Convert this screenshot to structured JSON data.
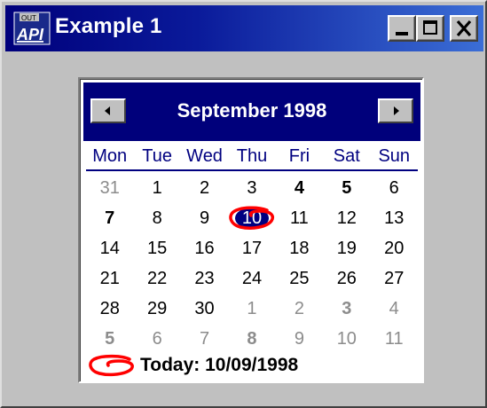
{
  "window": {
    "title": "Example 1",
    "icon": "api-app-icon",
    "buttons": [
      "minimize",
      "maximize",
      "close"
    ]
  },
  "calendar": {
    "month_label": "September 1998",
    "prev_label": "previous-month",
    "next_label": "next-month",
    "weekdays": [
      "Mon",
      "Tue",
      "Wed",
      "Thu",
      "Fri",
      "Sat",
      "Sun"
    ],
    "weeks": [
      [
        {
          "d": "31",
          "other": true,
          "bold": false
        },
        {
          "d": "1",
          "other": false,
          "bold": false
        },
        {
          "d": "2",
          "other": false,
          "bold": false
        },
        {
          "d": "3",
          "other": false,
          "bold": false
        },
        {
          "d": "4",
          "other": false,
          "bold": true
        },
        {
          "d": "5",
          "other": false,
          "bold": true
        },
        {
          "d": "6",
          "other": false,
          "bold": false
        }
      ],
      [
        {
          "d": "7",
          "other": false,
          "bold": true
        },
        {
          "d": "8",
          "other": false,
          "bold": false
        },
        {
          "d": "9",
          "other": false,
          "bold": false
        },
        {
          "d": "10",
          "other": false,
          "bold": false,
          "selected": true,
          "today": true
        },
        {
          "d": "11",
          "other": false,
          "bold": false
        },
        {
          "d": "12",
          "other": false,
          "bold": false
        },
        {
          "d": "13",
          "other": false,
          "bold": false
        }
      ],
      [
        {
          "d": "14",
          "other": false,
          "bold": false
        },
        {
          "d": "15",
          "other": false,
          "bold": false
        },
        {
          "d": "16",
          "other": false,
          "bold": false
        },
        {
          "d": "17",
          "other": false,
          "bold": false
        },
        {
          "d": "18",
          "other": false,
          "bold": false
        },
        {
          "d": "19",
          "other": false,
          "bold": false
        },
        {
          "d": "20",
          "other": false,
          "bold": false
        }
      ],
      [
        {
          "d": "21",
          "other": false,
          "bold": false
        },
        {
          "d": "22",
          "other": false,
          "bold": false
        },
        {
          "d": "23",
          "other": false,
          "bold": false
        },
        {
          "d": "24",
          "other": false,
          "bold": false
        },
        {
          "d": "25",
          "other": false,
          "bold": false
        },
        {
          "d": "26",
          "other": false,
          "bold": false
        },
        {
          "d": "27",
          "other": false,
          "bold": false
        }
      ],
      [
        {
          "d": "28",
          "other": false,
          "bold": false
        },
        {
          "d": "29",
          "other": false,
          "bold": false
        },
        {
          "d": "30",
          "other": false,
          "bold": false
        },
        {
          "d": "1",
          "other": true,
          "bold": false
        },
        {
          "d": "2",
          "other": true,
          "bold": false
        },
        {
          "d": "3",
          "other": true,
          "bold": true
        },
        {
          "d": "4",
          "other": true,
          "bold": false
        }
      ],
      [
        {
          "d": "5",
          "other": true,
          "bold": true
        },
        {
          "d": "6",
          "other": true,
          "bold": false
        },
        {
          "d": "7",
          "other": true,
          "bold": false
        },
        {
          "d": "8",
          "other": true,
          "bold": true
        },
        {
          "d": "9",
          "other": true,
          "bold": false
        },
        {
          "d": "10",
          "other": true,
          "bold": false
        },
        {
          "d": "11",
          "other": true,
          "bold": false
        }
      ]
    ],
    "today_label": "Today: 10/09/1998"
  },
  "colors": {
    "title_bar": "#00007b",
    "header_bg": "#00007b",
    "selected_bg": "#000080",
    "today_ring": "#ff0000",
    "weekday_text": "#000080",
    "other_month_text": "#8c8c8c",
    "window_bg": "#c0c0c0"
  }
}
